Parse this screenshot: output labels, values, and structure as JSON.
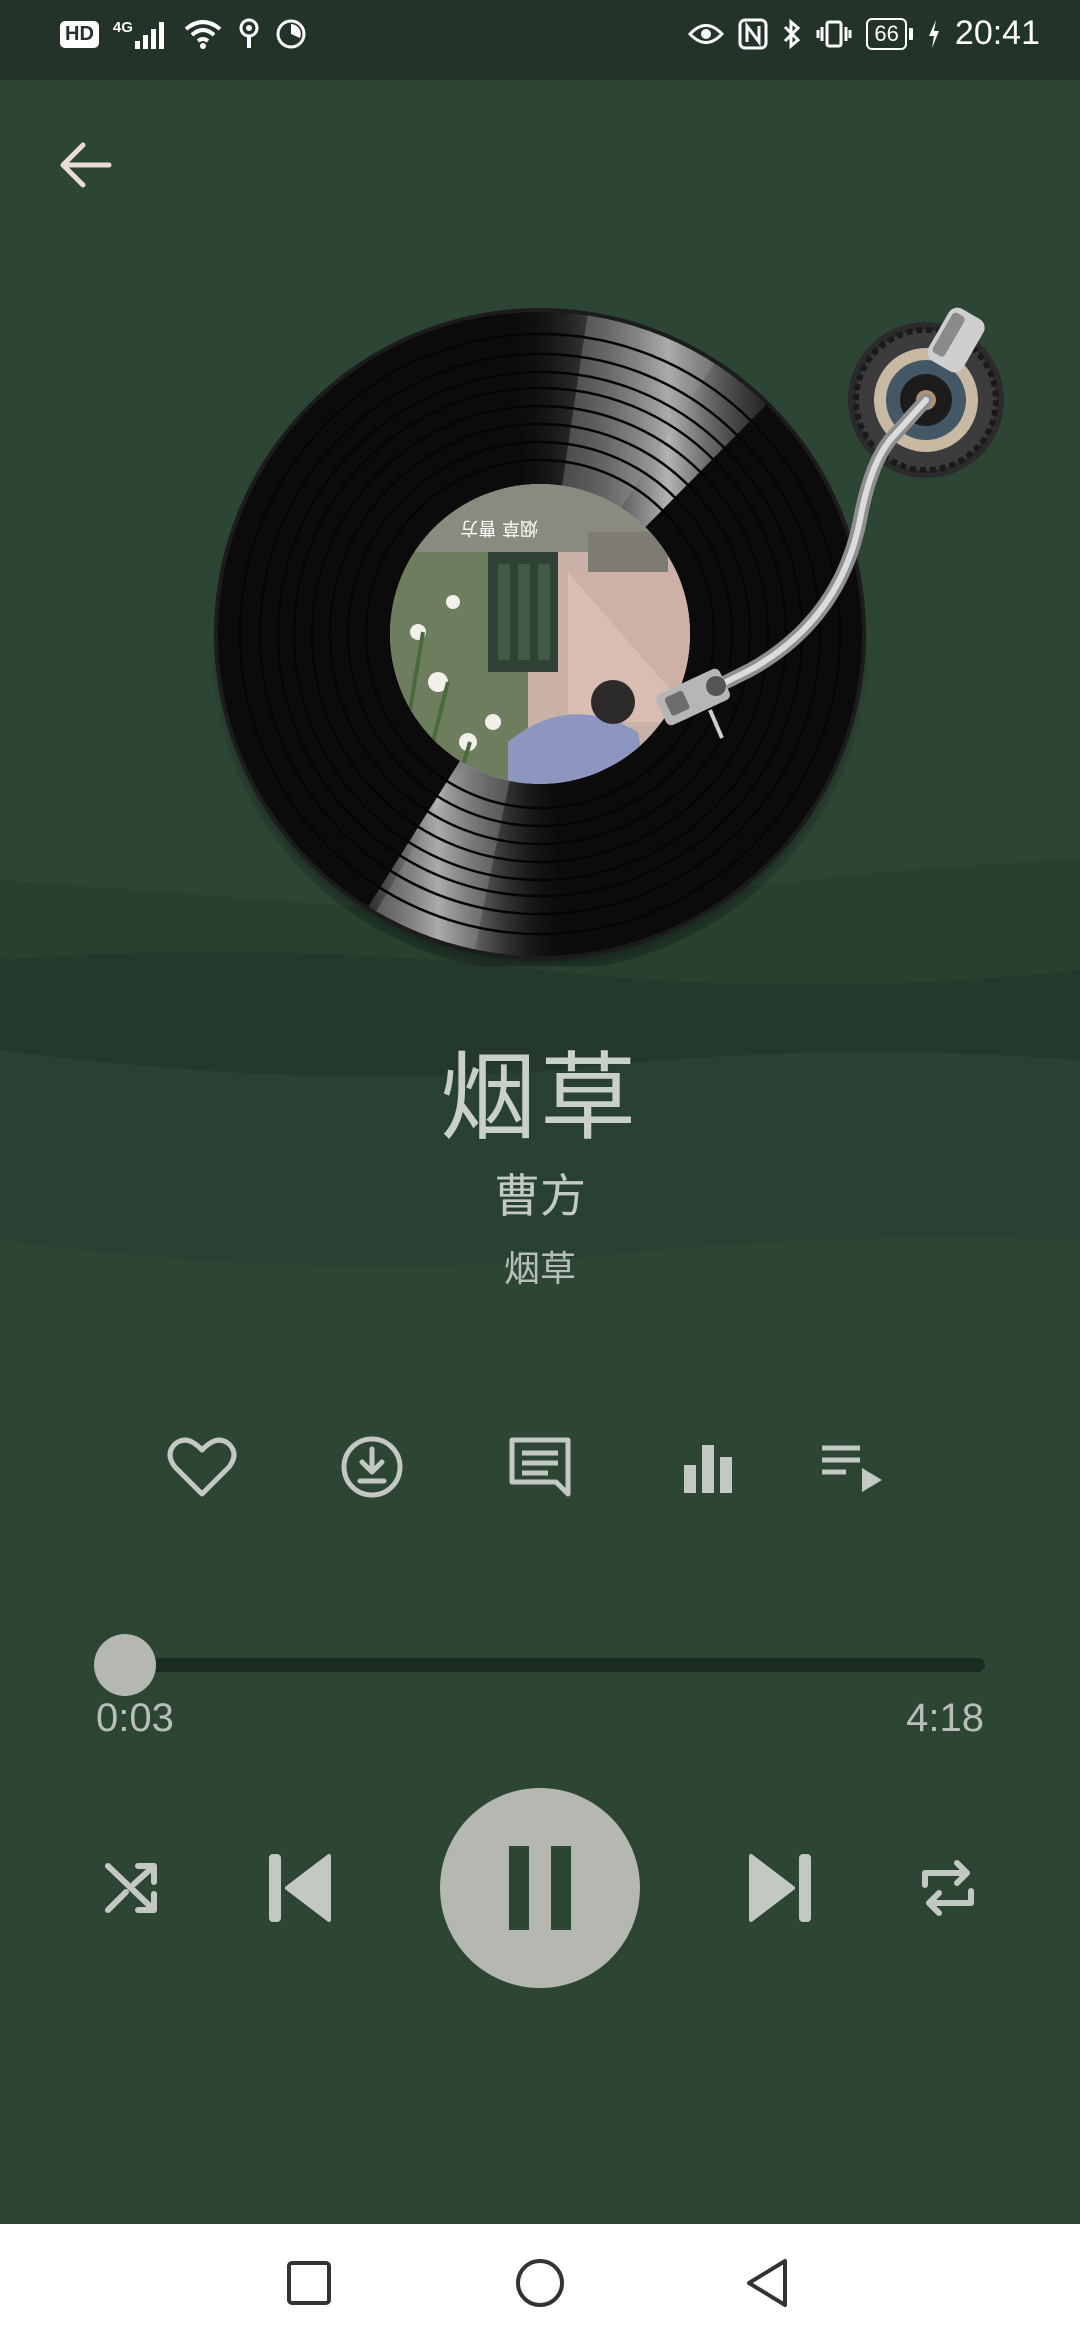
{
  "status_bar": {
    "hd_label": "HD",
    "network_label": "4G",
    "battery_level": "66",
    "time": "20:41"
  },
  "song": {
    "title": "烟草",
    "artist": "曹方",
    "album": "烟草",
    "cover_text": "烟草 曹方"
  },
  "playback": {
    "current_time": "0:03",
    "total_time": "4:18",
    "progress_fraction": 0.012,
    "state": "playing"
  },
  "colors": {
    "background": "#2d4535",
    "status_bar": "#223328",
    "accent": "#b4b8b0",
    "track": "#1b2d21",
    "nav_bar": "#ffffff"
  },
  "icons": {
    "back": "arrow-left-icon",
    "like": "heart-icon",
    "download": "download-icon",
    "comment": "comment-icon",
    "equalizer": "bar-chart-icon",
    "playlist": "playlist-icon",
    "shuffle": "shuffle-icon",
    "previous": "skip-previous-icon",
    "pause": "pause-icon",
    "next": "skip-next-icon",
    "repeat": "repeat-icon",
    "nav_recents": "square-icon",
    "nav_home": "circle-icon",
    "nav_back": "triangle-back-icon"
  }
}
